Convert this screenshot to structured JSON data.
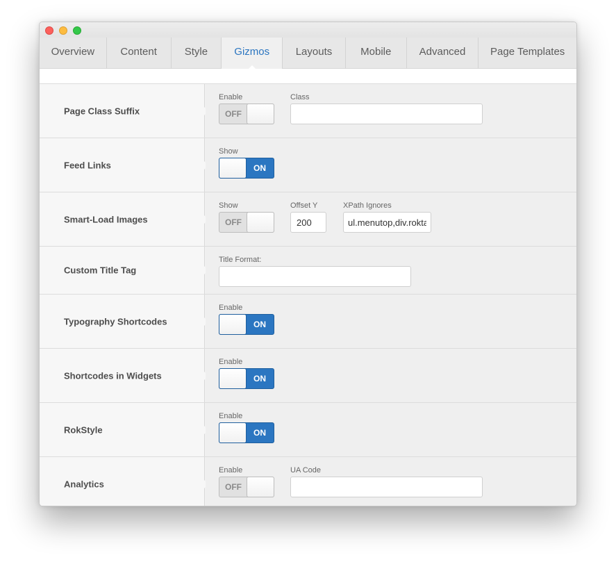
{
  "tabs": [
    "Overview",
    "Content",
    "Style",
    "Gizmos",
    "Layouts",
    "Mobile",
    "Advanced",
    "Page Templates"
  ],
  "active_tab": "Gizmos",
  "colors": {
    "accent": "#2b75c0",
    "toggle_on": "#2b76c1"
  },
  "rows": {
    "page_class_suffix": {
      "title": "Page Class Suffix",
      "enable_label": "Enable",
      "toggle": "OFF",
      "class_label": "Class",
      "class_value": ""
    },
    "feed_links": {
      "title": "Feed Links",
      "show_label": "Show",
      "toggle": "ON"
    },
    "smart_load": {
      "title": "Smart-Load Images",
      "show_label": "Show",
      "toggle": "OFF",
      "offset_label": "Offset Y",
      "offset_value": "200",
      "xpath_label": "XPath Ignores",
      "xpath_value": "ul.menutop,div.rokta"
    },
    "custom_title": {
      "title": "Custom Title Tag",
      "format_label": "Title Format:",
      "format_value": ""
    },
    "typography": {
      "title": "Typography Shortcodes",
      "enable_label": "Enable",
      "toggle": "ON"
    },
    "widgets": {
      "title": "Shortcodes in Widgets",
      "enable_label": "Enable",
      "toggle": "ON"
    },
    "rokstyle": {
      "title": "RokStyle",
      "enable_label": "Enable",
      "toggle": "ON"
    },
    "analytics": {
      "title": "Analytics",
      "enable_label": "Enable",
      "toggle": "OFF",
      "ua_label": "UA Code",
      "ua_value": ""
    }
  }
}
